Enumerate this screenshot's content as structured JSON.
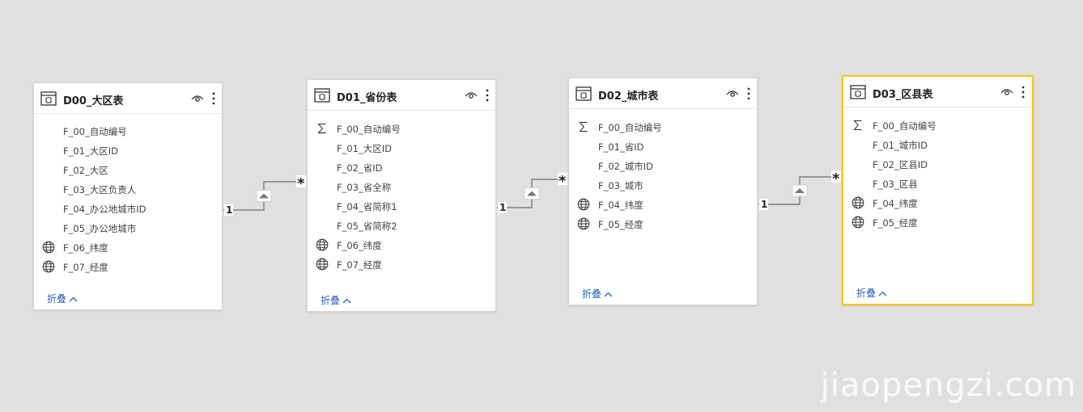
{
  "tables": [
    {
      "title": "D00_大区表",
      "fields": [
        {
          "name": "F_00_自动编号",
          "icon": "none"
        },
        {
          "name": "F_01_大区ID",
          "icon": "none"
        },
        {
          "name": "F_02_大区",
          "icon": "none"
        },
        {
          "name": "F_03_大区负责人",
          "icon": "none"
        },
        {
          "name": "F_04_办公地城市ID",
          "icon": "none"
        },
        {
          "name": "F_05_办公地城市",
          "icon": "none"
        },
        {
          "name": "F_06_纬度",
          "icon": "globe-icon"
        },
        {
          "name": "F_07_经度",
          "icon": "globe-icon"
        }
      ],
      "collapse_label": "折叠",
      "selected": false
    },
    {
      "title": "D01_省份表",
      "fields": [
        {
          "name": "F_00_自动编号",
          "icon": "sigma-icon"
        },
        {
          "name": "F_01_大区ID",
          "icon": "none"
        },
        {
          "name": "F_02_省ID",
          "icon": "none"
        },
        {
          "name": "F_03_省全称",
          "icon": "none"
        },
        {
          "name": "F_04_省简称1",
          "icon": "none"
        },
        {
          "name": "F_05_省简称2",
          "icon": "none"
        },
        {
          "name": "F_06_纬度",
          "icon": "globe-icon"
        },
        {
          "name": "F_07_经度",
          "icon": "globe-icon"
        }
      ],
      "collapse_label": "折叠",
      "selected": false
    },
    {
      "title": "D02_城市表",
      "fields": [
        {
          "name": "F_00_自动编号",
          "icon": "sigma-icon"
        },
        {
          "name": "F_01_省ID",
          "icon": "none"
        },
        {
          "name": "F_02_城市ID",
          "icon": "none"
        },
        {
          "name": "F_03_城市",
          "icon": "none"
        },
        {
          "name": "F_04_纬度",
          "icon": "globe-icon"
        },
        {
          "name": "F_05_经度",
          "icon": "globe-icon"
        }
      ],
      "collapse_label": "折叠",
      "selected": false
    },
    {
      "title": "D03_区县表",
      "fields": [
        {
          "name": "F_00_自动编号",
          "icon": "sigma-icon"
        },
        {
          "name": "F_01_城市ID",
          "icon": "none"
        },
        {
          "name": "F_02_区县ID",
          "icon": "none"
        },
        {
          "name": "F_03_区县",
          "icon": "none"
        },
        {
          "name": "F_04_纬度",
          "icon": "globe-icon"
        },
        {
          "name": "F_05_经度",
          "icon": "globe-icon"
        }
      ],
      "collapse_label": "折叠",
      "selected": true
    }
  ],
  "relationships": [
    {
      "one_label": "1",
      "many_label": "*",
      "direction": "single"
    },
    {
      "one_label": "1",
      "many_label": "*",
      "direction": "single"
    },
    {
      "one_label": "1",
      "many_label": "*",
      "direction": "single"
    }
  ],
  "colors": {
    "canvas": "#e1e0de",
    "selected_border": "#f2c811",
    "link": "#2563b8",
    "relationship_line": "#6b6b6b"
  },
  "watermark": "jiaopengzi.com"
}
